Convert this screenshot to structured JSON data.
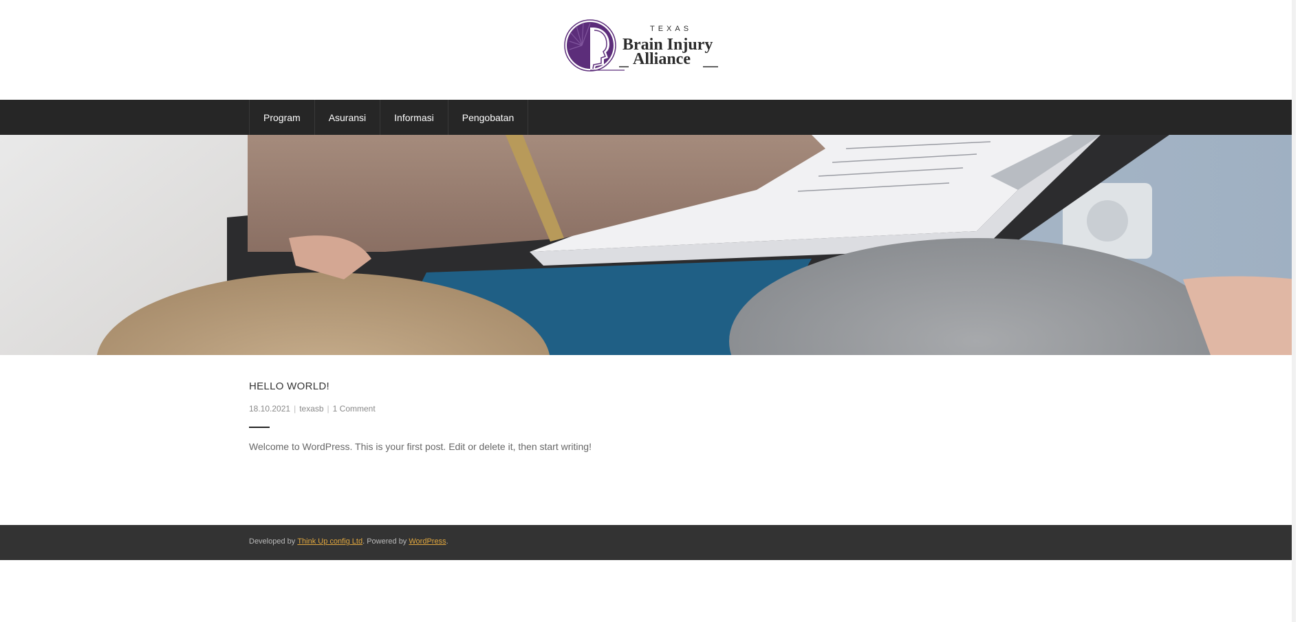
{
  "logo": {
    "small_text": "TEXAS",
    "line1": "Brain Injury",
    "line2": "Alliance",
    "colors": {
      "purple": "#5c2d7a",
      "text": "#2b2b2b"
    }
  },
  "nav": {
    "items": [
      {
        "label": "Program"
      },
      {
        "label": "Asuransi"
      },
      {
        "label": "Informasi"
      },
      {
        "label": "Pengobatan"
      }
    ]
  },
  "post": {
    "title": "HELLO WORLD!",
    "date": "18.10.2021",
    "author": "texasb",
    "comments": "1 Comment",
    "excerpt": "Welcome to WordPress. This is your first post. Edit or delete it, then start writing!"
  },
  "footer": {
    "developed_by": "Developed by ",
    "developer_link": "Think Up config Ltd",
    "powered_by": ". Powered by ",
    "powered_link": "WordPress",
    "end": "."
  },
  "colors": {
    "nav_bg": "#262626",
    "footer_bg": "#333333",
    "link_accent": "#e2a83f"
  }
}
